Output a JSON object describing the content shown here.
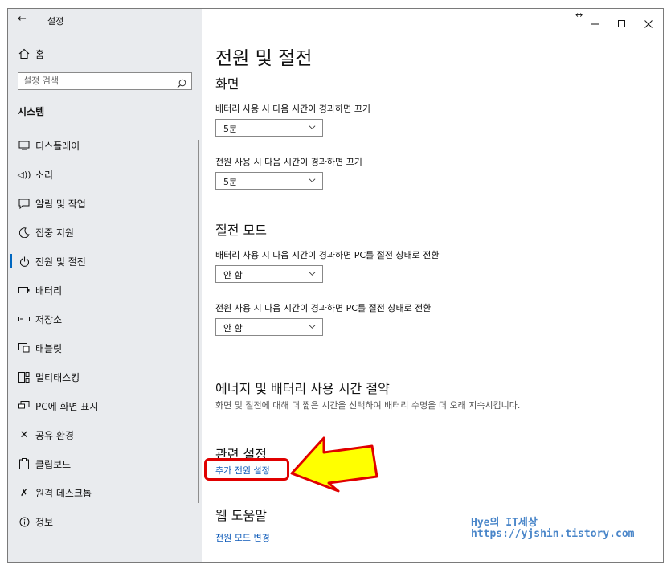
{
  "window": {
    "title": "설정",
    "back_icon": "back-arrow-icon",
    "controls": {
      "resize_icon": "resize-icon",
      "minimize_icon": "minimize-icon",
      "maximize_icon": "maximize-icon",
      "close_icon": "close-icon"
    }
  },
  "sidebar": {
    "home_label": "홈",
    "search_placeholder": "설정 검색",
    "section_title": "시스템",
    "items": [
      {
        "label": "디스플레이",
        "icon": "display-icon"
      },
      {
        "label": "소리",
        "icon": "sound-icon"
      },
      {
        "label": "알림 및 작업",
        "icon": "notification-icon"
      },
      {
        "label": "집중 지원",
        "icon": "focus-assist-icon"
      },
      {
        "label": "전원 및 절전",
        "icon": "power-icon",
        "selected": true
      },
      {
        "label": "배터리",
        "icon": "battery-icon"
      },
      {
        "label": "저장소",
        "icon": "storage-icon"
      },
      {
        "label": "태블릿",
        "icon": "tablet-icon"
      },
      {
        "label": "멀티태스킹",
        "icon": "multitasking-icon"
      },
      {
        "label": "PC에 화면 표시",
        "icon": "project-icon"
      },
      {
        "label": "공유 환경",
        "icon": "shared-experiences-icon"
      },
      {
        "label": "클립보드",
        "icon": "clipboard-icon"
      },
      {
        "label": "원격 데스크톱",
        "icon": "remote-desktop-icon"
      },
      {
        "label": "정보",
        "icon": "info-icon"
      }
    ]
  },
  "main": {
    "page_title": "전원 및 절전",
    "screen": {
      "heading": "화면",
      "battery_label": "배터리 사용 시 다음 시간이 경과하면 끄기",
      "battery_value": "5분",
      "plugged_label": "전원 사용 시 다음 시간이 경과하면 끄기",
      "plugged_value": "5분"
    },
    "sleep": {
      "heading": "절전 모드",
      "battery_label": "배터리 사용 시 다음 시간이 경과하면 PC를 절전 상태로 전환",
      "battery_value": "안 함",
      "plugged_label": "전원 사용 시 다음 시간이 경과하면 PC를 절전 상태로 전환",
      "plugged_value": "안 함"
    },
    "energy": {
      "heading": "에너지 및 배터리 사용 시간 절약",
      "description": "화면 및 절전에 대해 더 짧은 시간을 선택하여 배터리 수명을 더 오래 지속시킵니다."
    },
    "related": {
      "heading": "관련 설정",
      "link": "추가 전원 설정"
    },
    "help": {
      "heading": "웹 도움말",
      "link": "전원 모드 변경"
    }
  },
  "annotation": {
    "highlight_color": "#e00000",
    "arrow_fill": "#ffff00"
  },
  "watermark": {
    "line1": "Hye의 IT세상",
    "line2": "https://yjshin.tistory.com"
  }
}
